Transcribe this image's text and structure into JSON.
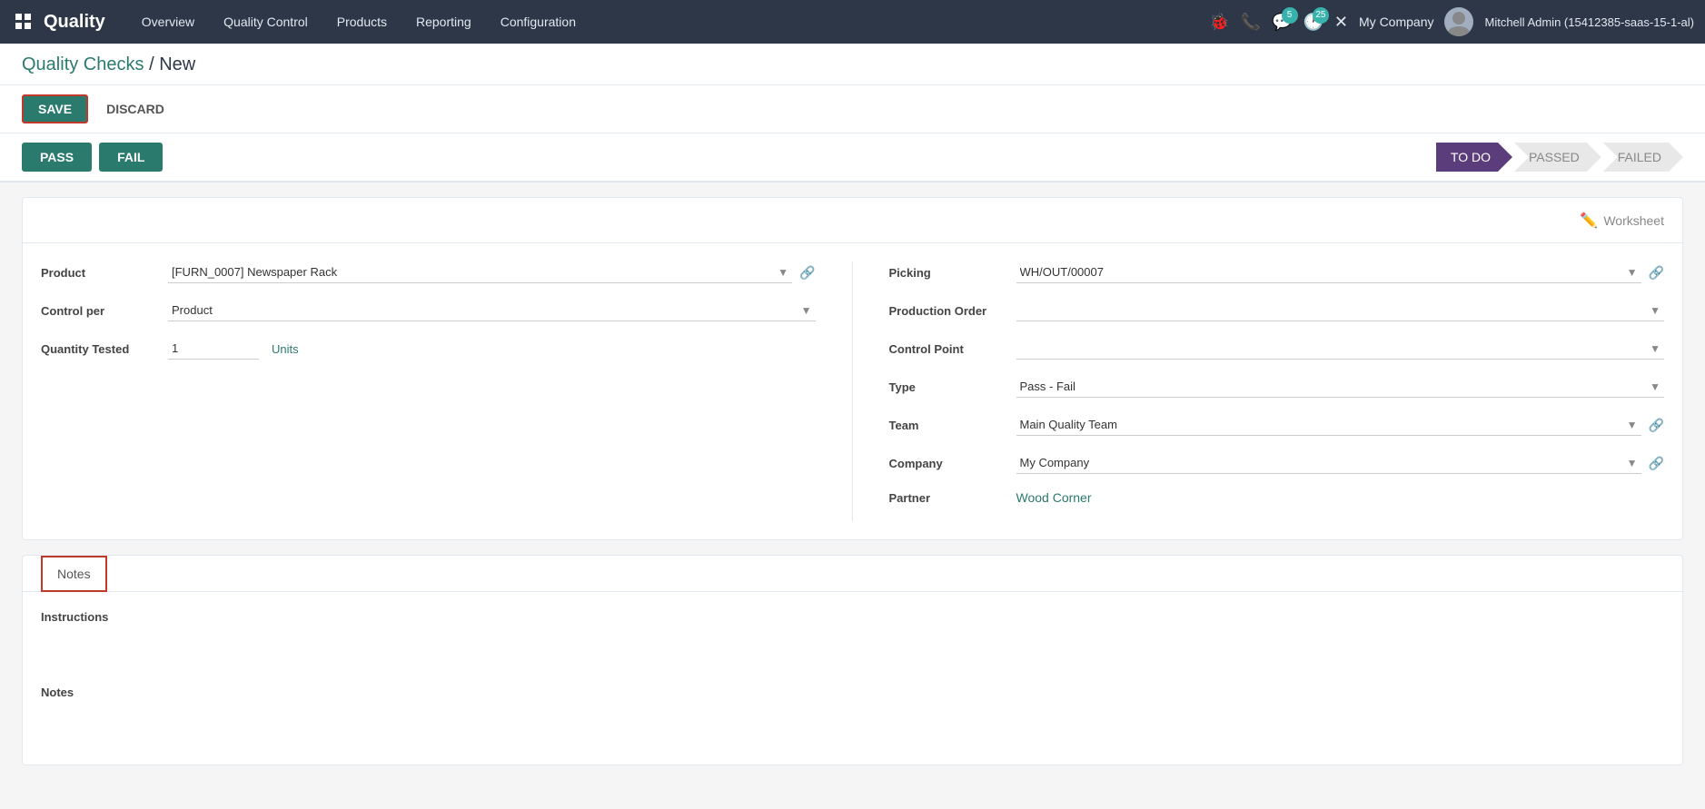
{
  "app": {
    "title": "Quality",
    "grid_icon": "⊞"
  },
  "nav": {
    "links": [
      {
        "label": "Overview",
        "id": "overview"
      },
      {
        "label": "Quality Control",
        "id": "quality-control"
      },
      {
        "label": "Products",
        "id": "products"
      },
      {
        "label": "Reporting",
        "id": "reporting"
      },
      {
        "label": "Configuration",
        "id": "configuration"
      }
    ],
    "icons": [
      {
        "name": "bug-icon",
        "symbol": "🐞"
      },
      {
        "name": "phone-icon",
        "symbol": "📞"
      },
      {
        "name": "chat-icon",
        "symbol": "💬",
        "badge": "5"
      },
      {
        "name": "timer-icon",
        "symbol": "🕐",
        "badge": "25"
      },
      {
        "name": "wrench-icon",
        "symbol": "✕"
      }
    ],
    "company": "My Company",
    "user": "Mitchell Admin (15412385-saas-15-1-al)"
  },
  "breadcrumb": {
    "parent": "Quality Checks",
    "current": "New"
  },
  "actions": {
    "save_label": "SAVE",
    "discard_label": "DISCARD"
  },
  "status_buttons": {
    "pass_label": "PASS",
    "fail_label": "FAIL"
  },
  "pipeline": {
    "steps": [
      {
        "label": "TO DO",
        "id": "todo",
        "active": true
      },
      {
        "label": "PASSED",
        "id": "passed",
        "active": false
      },
      {
        "label": "FAILED",
        "id": "failed",
        "active": false
      }
    ]
  },
  "worksheet": {
    "label": "Worksheet"
  },
  "form": {
    "left": {
      "fields": [
        {
          "label": "Product",
          "value": "[FURN_0007] Newspaper Rack",
          "type": "select",
          "has_link": true
        },
        {
          "label": "Control per",
          "value": "Product",
          "type": "select",
          "has_link": false
        },
        {
          "label": "Quantity Tested",
          "value": "1",
          "type": "input",
          "unit": "Units",
          "has_link": false
        }
      ]
    },
    "right": {
      "fields": [
        {
          "label": "Picking",
          "value": "WH/OUT/00007",
          "type": "select",
          "has_link": true
        },
        {
          "label": "Production Order",
          "value": "",
          "type": "select",
          "has_link": false
        },
        {
          "label": "Control Point",
          "value": "",
          "type": "select",
          "has_link": false
        },
        {
          "label": "Type",
          "value": "Pass - Fail",
          "type": "select",
          "has_link": false
        },
        {
          "label": "Team",
          "value": "Main Quality Team",
          "type": "select",
          "has_link": true
        },
        {
          "label": "Company",
          "value": "My Company",
          "type": "select",
          "has_link": true
        },
        {
          "label": "Partner",
          "value": "Wood Corner",
          "type": "link",
          "has_link": false
        }
      ]
    }
  },
  "notes": {
    "tab_label": "Notes",
    "sections": [
      {
        "title": "Instructions",
        "placeholder": ""
      },
      {
        "title": "Notes",
        "placeholder": ""
      }
    ]
  }
}
